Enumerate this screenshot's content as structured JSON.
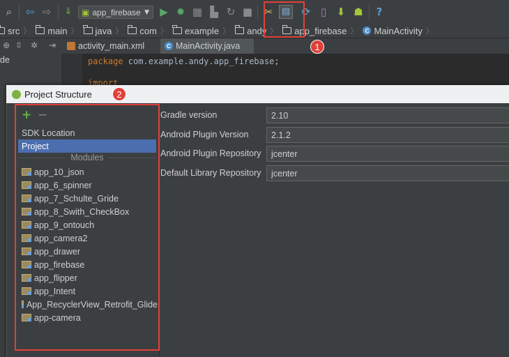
{
  "toolbar": {
    "run_config": "app_firebase",
    "icons": [
      "search-icon",
      "back-arrow-icon",
      "forward-arrow-icon",
      "make-project-icon",
      "android-icon",
      "run-icon",
      "debug-icon",
      "coverage-icon",
      "attach-debugger-icon",
      "rerun-icon",
      "stop-icon",
      "settings-icon",
      "project-structure-icon",
      "sync-gradle-icon",
      "avd-manager-icon",
      "sdk-manager-icon",
      "android-monitor-icon",
      "help-icon"
    ]
  },
  "breadcrumb": [
    {
      "label": "src",
      "icon": "folder-icon"
    },
    {
      "label": "main",
      "icon": "folder-icon"
    },
    {
      "label": "java",
      "icon": "folder-icon"
    },
    {
      "label": "com",
      "icon": "folder-icon"
    },
    {
      "label": "example",
      "icon": "folder-icon"
    },
    {
      "label": "andy",
      "icon": "folder-icon"
    },
    {
      "label": "app_firebase",
      "icon": "folder-icon"
    },
    {
      "label": "MainActivity",
      "icon": "class-icon"
    }
  ],
  "side_panel": {
    "label_fragment": "de"
  },
  "editor": {
    "tabs": [
      {
        "label": "activity_main.xml",
        "icon": "xml-file-icon"
      },
      {
        "label": "MainActivity.java",
        "icon": "class-icon"
      }
    ],
    "code_line_1_keyword": "package",
    "code_line_1_rest": " com.example.andy.app_firebase;",
    "code_line_2": "import"
  },
  "annotations": {
    "badge_1": "1",
    "badge_2": "2",
    "accent_color": "#e2403a"
  },
  "dialog": {
    "title": "Project Structure",
    "add_label": "+",
    "remove_label": "−",
    "side_items": [
      "SDK Location",
      "Project"
    ],
    "selected_item": "Project",
    "modules_header": "Modules",
    "modules": [
      "app_10_json",
      "app_6_spinner",
      "app_7_Schulte_Gride",
      "app_8_Swith_CheckBox",
      "app_9_ontouch",
      "app_camera2",
      "app_drawer",
      "app_firebase",
      "app_flipper",
      "app_Intent",
      "App_RecyclerView_Retrofit_Glide",
      "app-camera"
    ],
    "fields": [
      {
        "label": "Gradle version",
        "value": "2.10"
      },
      {
        "label": "Android Plugin Version",
        "value": "2.1.2"
      },
      {
        "label": "Android Plugin Repository",
        "value": "jcenter"
      },
      {
        "label": "Default Library Repository",
        "value": "jcenter"
      }
    ]
  }
}
